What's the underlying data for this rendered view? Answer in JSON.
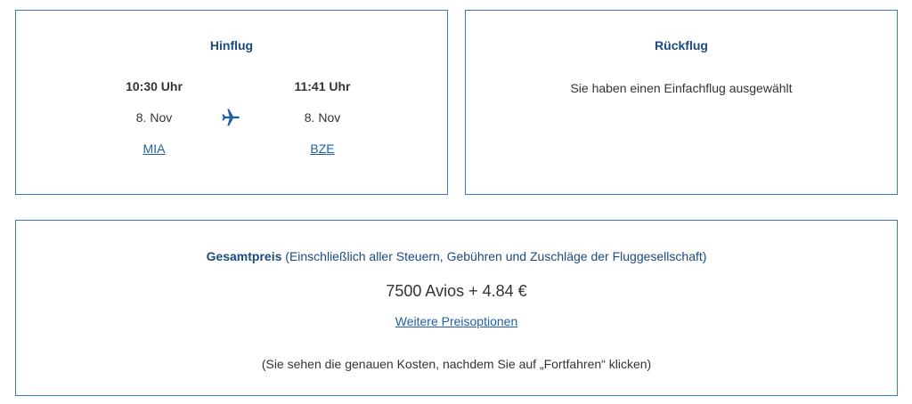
{
  "outbound": {
    "title": "Hinflug",
    "departure": {
      "time": "10:30 Uhr",
      "date": "8. Nov",
      "airport": "MIA"
    },
    "arrival": {
      "time": "11:41 Uhr",
      "date": "8. Nov",
      "airport": "BZE"
    },
    "icon": "airplane-icon"
  },
  "return": {
    "title": "Rückflug",
    "message": "Sie haben einen Einfachflug ausgewählt"
  },
  "price": {
    "label": "Gesamtpreis",
    "label_note": "(Einschließlich aller Steuern, Gebühren und Zuschläge der Fluggesellschaft)",
    "amount": "7500 Avios + 4.84 €",
    "more_options_link": "Weitere Preisoptionen",
    "note": "(Sie sehen die genauen Kosten, nachdem Sie auf „Fortfahren“ klicken)"
  },
  "colors": {
    "border": "#3a7ab8",
    "heading": "#1a4a80",
    "link": "#1f5fa5",
    "text": "#333333"
  }
}
